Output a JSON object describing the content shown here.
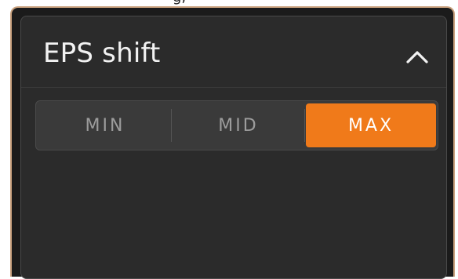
{
  "window": {
    "top_partial_text": "g,"
  },
  "panel": {
    "title": "EPS shift",
    "collapse_icon": "chevron-up-icon"
  },
  "segmented_control": {
    "options": [
      "MIN",
      "MID",
      "MAX"
    ],
    "selected": "MAX"
  },
  "colors": {
    "accent": "#f07a1a",
    "panel_bg": "#2b2b2b",
    "frame_border": "#c9a17e",
    "inactive_text": "#9c9c9c"
  }
}
